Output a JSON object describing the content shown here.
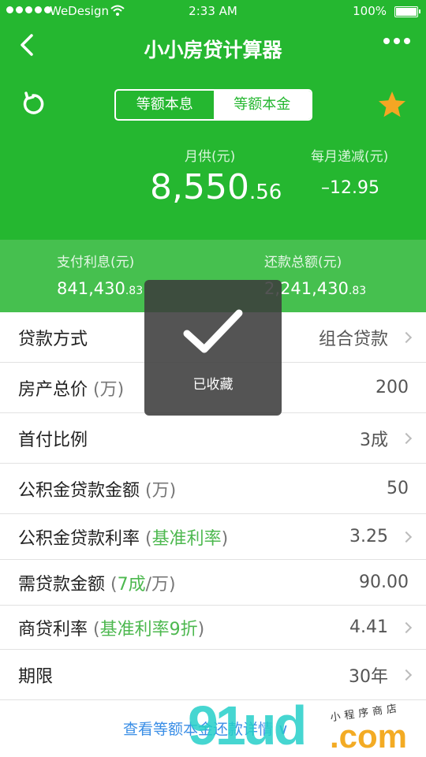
{
  "status": {
    "carrier": "WeDesign",
    "time": "2:33 AM",
    "battery": "100%"
  },
  "nav": {
    "title": "小小房贷计算器"
  },
  "segment": {
    "options": [
      "等额本息",
      "等额本金"
    ],
    "active_index": 1
  },
  "monthly": {
    "label": "月供(元)",
    "value_int": "8,550",
    "value_dec": ".56"
  },
  "decrease": {
    "label": "每月递减(元)",
    "value": "–12.95"
  },
  "summary": {
    "interest": {
      "label": "支付利息(元)",
      "value_int": "841,430",
      "value_dec": ".83"
    },
    "total": {
      "label": "还款总额(元)",
      "value_int": "2,241,430",
      "value_dec": ".83"
    }
  },
  "rows": [
    {
      "label": "贷款方式",
      "value": "组合贷款"
    },
    {
      "label": "房产总价",
      "paren": "(万)",
      "value": "200"
    },
    {
      "label": "首付比例",
      "value": "3成"
    },
    {
      "label": "公积金贷款金额",
      "paren": "(万)",
      "value": "50"
    },
    {
      "label": "公积金贷款利率",
      "paren_open": "(",
      "hl": "基准利率",
      "paren_close": ")",
      "value": "3.25"
    },
    {
      "label": "需贷款金额",
      "paren_open": "(",
      "hl": "7成",
      "paren_close": "/万)",
      "value": "90.00"
    },
    {
      "label": "商贷利率",
      "paren_open": "(",
      "hl": "基准利率9折",
      "paren_close": ")",
      "value": "4.41"
    },
    {
      "label": "期限",
      "value": "30年"
    }
  ],
  "footer": {
    "link": "查看等额本金还款详情 ∨"
  },
  "toast": {
    "text": "已收藏"
  },
  "watermark": {
    "main": "91ud",
    "com": ".com",
    "sub": "小程序商店"
  },
  "colors": {
    "brand_green": "#25b730",
    "summary_green": "#46c04f",
    "link_blue": "#3a8ee6",
    "star": "#f5a623"
  }
}
